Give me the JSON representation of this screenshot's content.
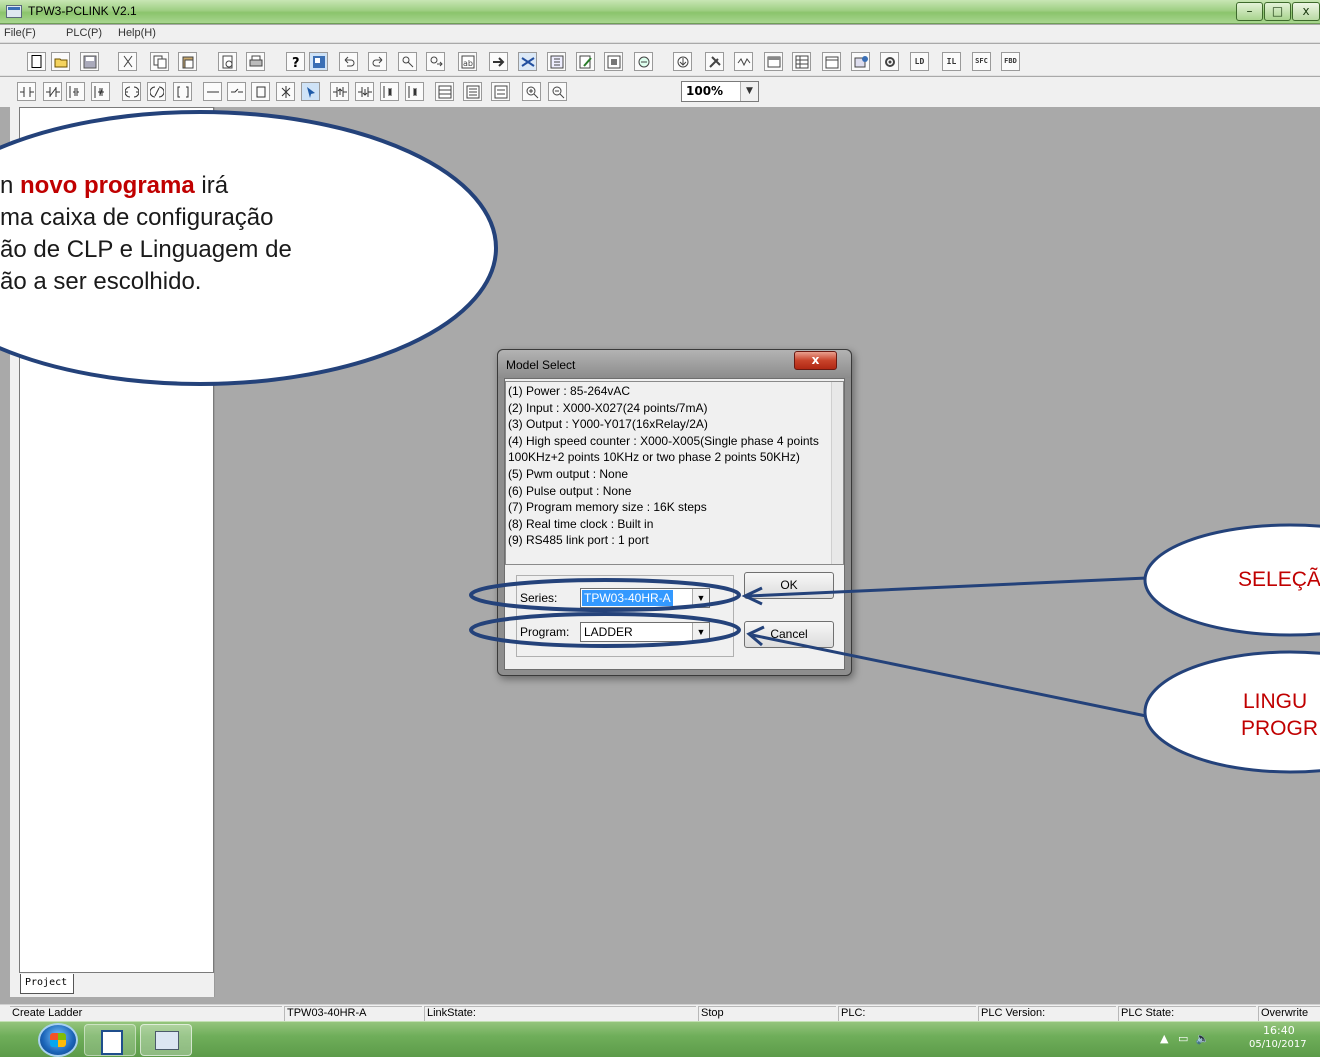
{
  "window": {
    "title": "TPW3-PCLINK V2.1",
    "minimize_glyph": "–",
    "maximize_glyph": "□",
    "close_glyph": "x"
  },
  "menu": [
    {
      "label": "File(F)"
    },
    {
      "label": "PLC(P)"
    },
    {
      "label": "Help(H)"
    }
  ],
  "toolbar1": {
    "text_buttons": [
      "LD",
      "IL",
      "SFC",
      "FBD"
    ]
  },
  "toolbar2": {
    "zoom": "100%"
  },
  "project_panel": {
    "tab_label": "Project"
  },
  "dialog": {
    "title": "Model Select",
    "close_glyph": "x",
    "info_lines": [
      "(1) Power : 85-264vAC",
      "(2) Input : X000-X027(24 points/7mA)",
      "(3) Output : Y000-Y017(16xRelay/2A)",
      "(4) High speed counter : X000-X005(Single phase 4 points 100KHz+2 points 10KHz or two phase 2 points 50KHz)",
      "(5) Pwm output : None",
      "(6) Pulse output : None",
      "(7) Program memory size : 16K steps",
      "(8) Real time clock : Built in",
      "(9) RS485 link port : 1 port"
    ],
    "series_label": "Series:",
    "series_value": "TPW03-40HR-A",
    "program_label": "Program:",
    "program_value": "LADDER",
    "ok_label": "OK",
    "cancel_label": "Cancel"
  },
  "status_bar": {
    "action": "Create Ladder",
    "model": "TPW03-40HR-A",
    "link_state": "LinkState:",
    "run_state": "Stop",
    "plc": "PLC:",
    "plc_version": "PLC Version:",
    "plc_state": "PLC State:",
    "mode": "Overwrite"
  },
  "taskbar": {
    "time": "16:40",
    "date": "05/10/2017"
  },
  "annotations": {
    "big_callout": {
      "line1_prefix": "n ",
      "line1_highlight": "novo programa",
      "line1_suffix": " irá",
      "line2": "ma caixa de configuração",
      "line3": "ão de CLP e Linguagem de",
      "line4": "ão a ser escolhido."
    },
    "series_callout": "SELEÇÃ",
    "language_callout_line1": "LINGU",
    "language_callout_line2": "PROGR"
  },
  "colors": {
    "titlebar": "#9fcf84",
    "workspace": "#a9a9a9",
    "callout_border": "#24427a",
    "callout_text": "#c00000",
    "selection": "#3399ff"
  }
}
